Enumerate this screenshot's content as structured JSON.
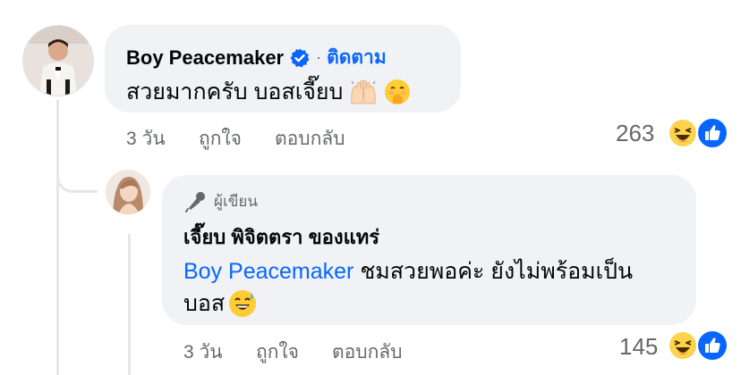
{
  "comment1": {
    "author": "Boy Peacemaker",
    "verified_icon": "verified-badge-icon",
    "separator": "·",
    "follow_label": "ติดตาม",
    "text": "สวยมากครับ บอสเจี๊ยบ",
    "emojis": [
      "raising-hands-emoji",
      "hand-over-mouth-emoji"
    ],
    "time": "3 วัน",
    "like_label": "ถูกใจ",
    "reply_label": "ตอบกลับ",
    "reaction_count": "263",
    "reactions": [
      "haha-reaction-icon",
      "like-reaction-icon"
    ]
  },
  "reply1": {
    "badge_label": "ผู้เขียน",
    "badge_icon": "microphone-icon",
    "author": "เจี๊ยบ พิจิตตรา ของแทร่",
    "mention": "Boy Peacemaker",
    "text_line1": " ชมสวยพอค่ะ ยังไม่พร้อมเป็น",
    "text_line2": "บอส",
    "emojis": [
      "grinning-sweat-emoji"
    ],
    "time": "3 วัน",
    "like_label": "ถูกใจ",
    "reply_label": "ตอบกลับ",
    "reaction_count": "145",
    "reactions": [
      "haha-reaction-icon",
      "like-reaction-icon"
    ]
  },
  "colors": {
    "bubble": "#f0f2f5",
    "link": "#0866ff",
    "meta": "#65676b",
    "thread_line": "#e4e6eb"
  }
}
